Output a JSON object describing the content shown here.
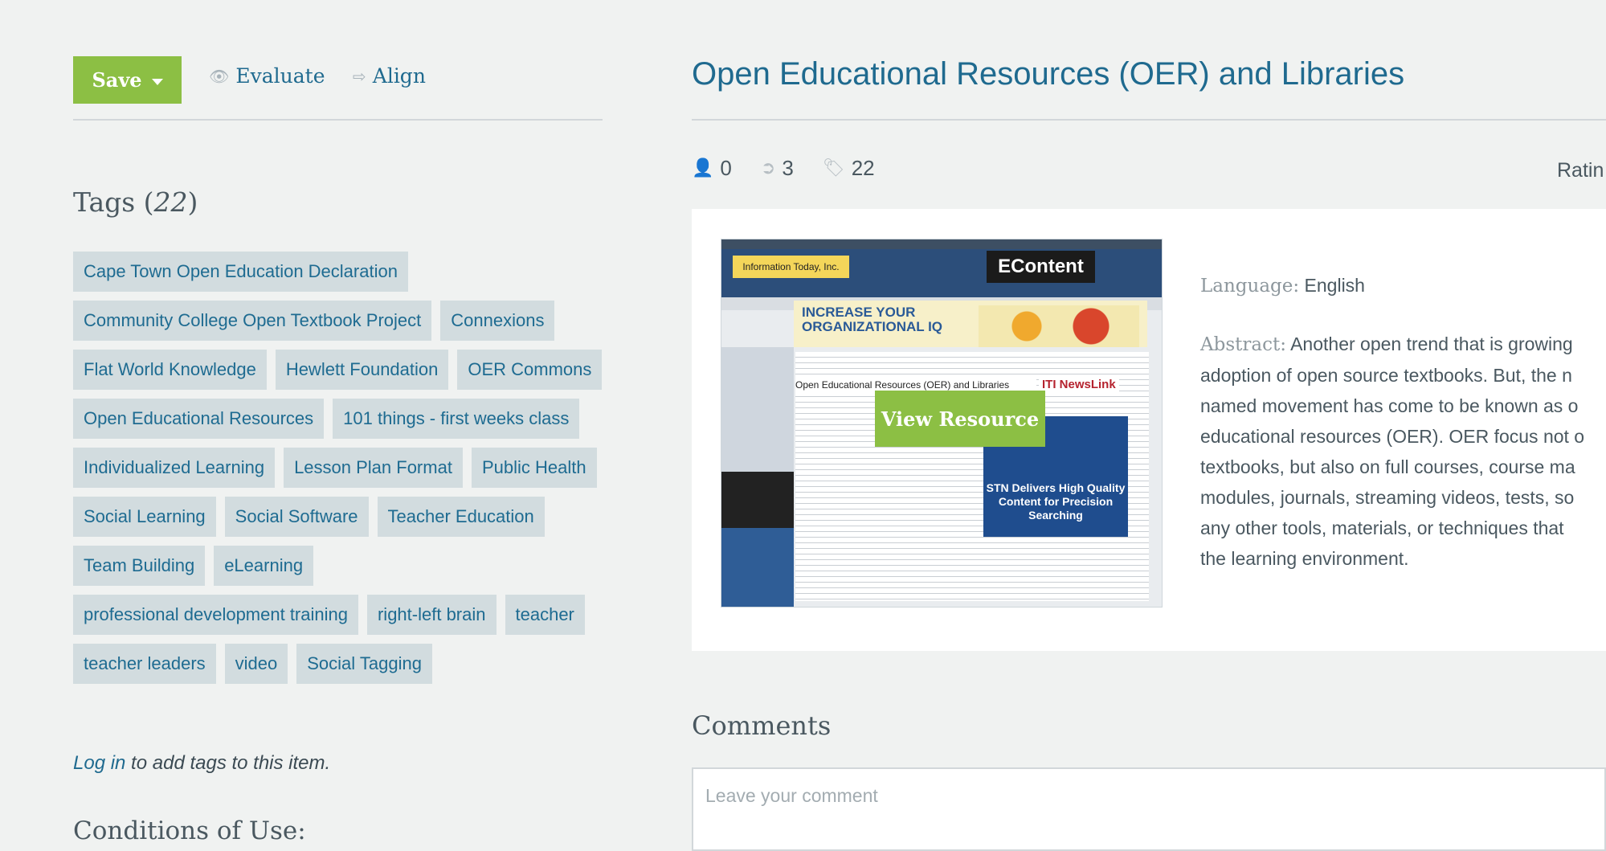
{
  "toolbar": {
    "save_label": "Save",
    "evaluate_label": "Evaluate",
    "align_label": "Align",
    "evaluate_icon": "eye-icon",
    "align_icon": "share-icon"
  },
  "tags": {
    "heading": "Tags (",
    "count": "22",
    "heading_close": ")",
    "items": [
      "Cape Town Open Education Declaration",
      "Community College Open Textbook Project",
      "Connexions",
      "Flat World Knowledge",
      "Hewlett Foundation",
      "OER Commons",
      "Open Educational Resources",
      "101 things - first weeks class",
      "Individualized Learning",
      "Lesson Plan Format",
      "Public Health",
      "Social Learning",
      "Social Software",
      "Teacher Education",
      "Team Building",
      "eLearning",
      "professional development training",
      "right-left brain",
      "teacher",
      "teacher leaders",
      "video",
      "Social Tagging"
    ],
    "login_link": "Log in",
    "login_suffix": " to add tags to this item."
  },
  "conditions": {
    "heading": "Conditions of Use:"
  },
  "resource": {
    "title": "Open Educational Resources (OER) and Libraries",
    "stats": {
      "users": "0",
      "shares": "3",
      "tags": "22"
    },
    "rating_label": "Ratin",
    "view_label": "View Resource",
    "language_label": "Language:",
    "language_value": "English",
    "abstract_label": "Abstract:",
    "abstract_lines": [
      "Another open trend that is growing",
      "adoption of open source textbooks. But, the n",
      "named movement has come to be known as o",
      "educational resources (OER). OER focus not o",
      "textbooks, but also on full courses, course ma",
      "modules, journals, streaming videos, tests, so",
      "any other tools, materials, or techniques that",
      "the learning environment."
    ],
    "thumbnail": {
      "logo_left": "Information Today, Inc.",
      "logo_right": "EContent",
      "banner": "INCREASE YOUR ORGANIZATIONAL IQ",
      "article_title": "Open Educational Resources (OER) and Libraries",
      "ad_title": "ITI NewsLink",
      "ad_text": "STN Delivers High Quality Content for Precision Searching"
    }
  },
  "comments": {
    "heading": "Comments",
    "placeholder": "Leave your comment"
  },
  "colors": {
    "accent_green": "#8cbf44",
    "link_blue": "#1f6a8f",
    "tag_bg": "#d2dcdf",
    "page_bg": "#f0f2f1"
  }
}
